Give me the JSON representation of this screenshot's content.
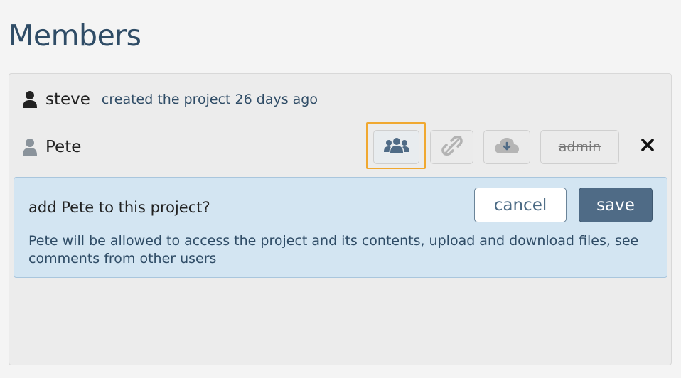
{
  "page": {
    "title": "Members"
  },
  "owner": {
    "name": "steve",
    "meta": "created the project 26 days ago",
    "icon": "user-icon"
  },
  "member": {
    "name": "Pete",
    "icon": "user-icon",
    "buttons": {
      "group_icon": "users-group-icon",
      "link_icon": "broken-link-icon",
      "download_icon": "cloud-download-icon",
      "admin_label": "admin",
      "remove_icon": "close-icon"
    }
  },
  "confirm": {
    "title": "add Pete to this project?",
    "description": "Pete will be allowed to access the project and its contents, upload and download files, see comments from other users",
    "cancel_label": "cancel",
    "save_label": "save"
  },
  "colors": {
    "title": "#2f4c66",
    "highlight": "#f0a830",
    "confirm_bg": "#d3e5f2",
    "save_bg": "#4f6b86"
  }
}
